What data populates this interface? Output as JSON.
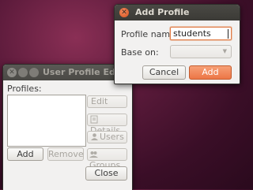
{
  "editor": {
    "title": "User Profile Editor",
    "profiles_label": "Profiles:",
    "edit_label": "Edit",
    "details_label": "Details",
    "users_label": "Users",
    "groups_label": "Groups",
    "add_label": "Add",
    "remove_label": "Remove",
    "close_label": "Close"
  },
  "dialog": {
    "title": "Add Profile",
    "profile_name_label": "Profile name:",
    "profile_name_value": "students",
    "base_on_label": "Base on:",
    "base_on_value": "",
    "cancel_label": "Cancel",
    "add_label": "Add"
  },
  "icons": {
    "close": "close-icon",
    "minimize": "minimize-icon",
    "maximize": "maximize-icon",
    "details": "details-icon",
    "users": "users-icon",
    "groups": "groups-icon",
    "dropdown": "chevron-down-icon"
  },
  "colors": {
    "accent": "#ec7646",
    "input_focus_border": "#e07a44",
    "titlebar": "#3b3a36"
  }
}
